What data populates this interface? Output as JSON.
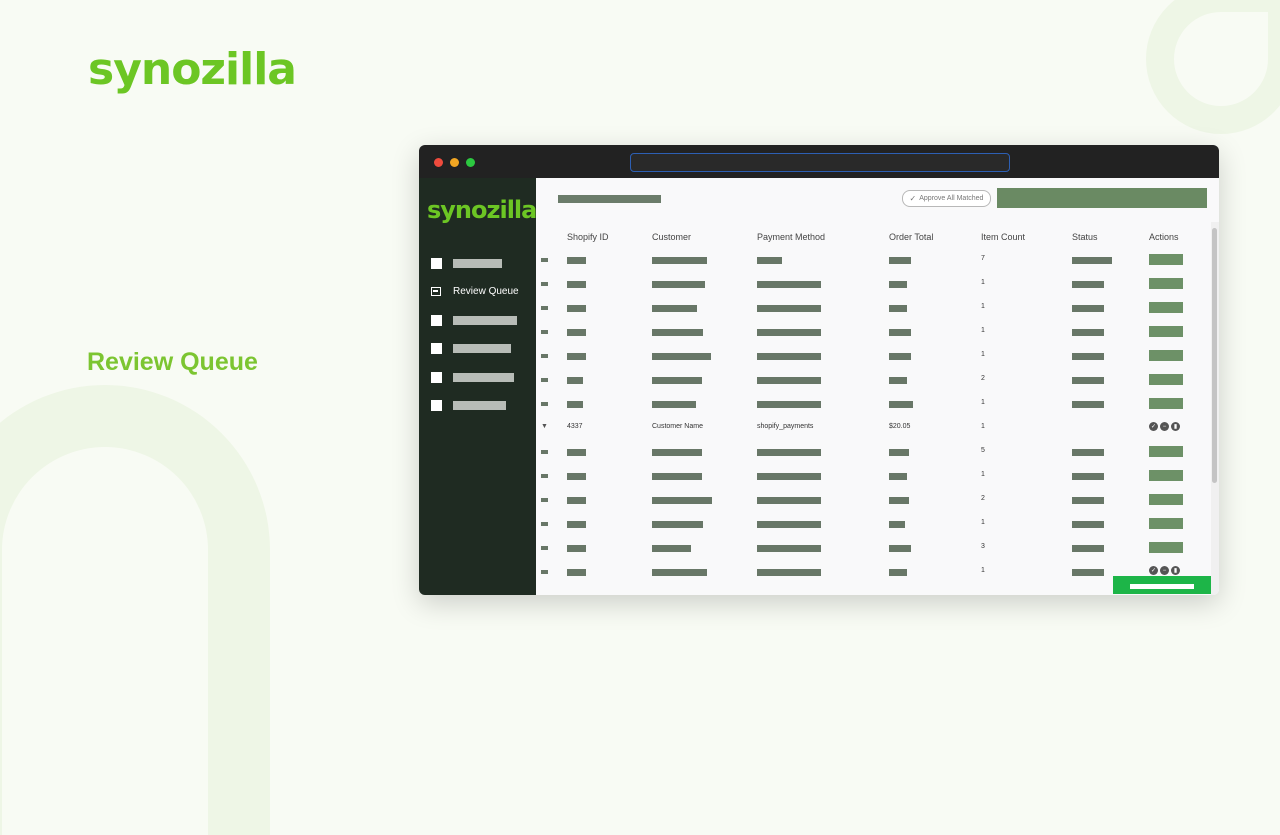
{
  "brand": {
    "name": "synozilla"
  },
  "hero_title": "Review Queue",
  "sidebar": {
    "logo": "synozilla",
    "active_label": "Review Queue"
  },
  "toolbar": {
    "approve_all": "Approve All Matched"
  },
  "table": {
    "headers": [
      "Shopify ID",
      "Customer",
      "Payment Method",
      "Order Total",
      "Item Count",
      "Status",
      "Actions"
    ],
    "item_counts": [
      "7",
      "1",
      "1",
      "1",
      "1",
      "2",
      "1",
      "1",
      "5",
      "1",
      "2",
      "1",
      "3",
      "1"
    ],
    "expanded_row": {
      "shopify_id": "4337",
      "customer": "Customer Name",
      "payment_method": "shopify_payments",
      "order_total": "$20.05",
      "item_count": "1"
    }
  },
  "icons": {
    "check": "check-icon",
    "minus": "minus-icon",
    "trash": "trash-icon"
  }
}
